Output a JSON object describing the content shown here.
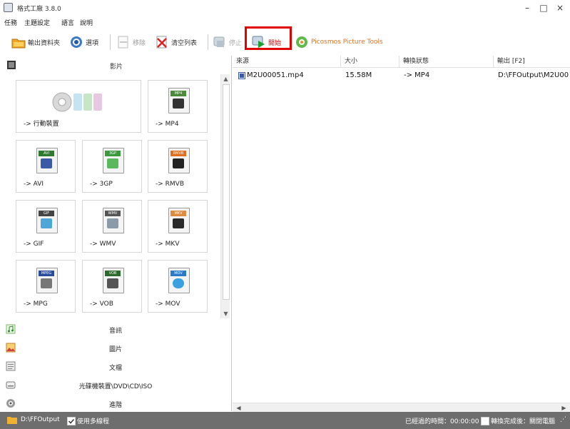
{
  "window": {
    "title": "格式工廠 3.8.0",
    "minimize_label": "–",
    "maximize_label": "□",
    "close_label": "×"
  },
  "menu": [
    "任務",
    "主題設定",
    "語言",
    "說明"
  ],
  "toolbar": {
    "output_folder": "輸出資料夾",
    "options": "選項",
    "remove": "移除",
    "clear_list": "清空列表",
    "stop": "停止",
    "start": "開始",
    "picosmos": "Picosmos Picture Tools",
    "accent": "#e00000"
  },
  "left": {
    "video_header": "影片",
    "tiles": [
      {
        "label": "-> 行動裝置",
        "icon": "mobile-device-icon"
      },
      {
        "label": "-> MP4",
        "badge": "MP4",
        "icon": "mp4-file-icon"
      },
      {
        "label": "-> AVI",
        "badge": "AVI",
        "icon": "avi-file-icon"
      },
      {
        "label": "-> 3GP",
        "badge": "3GP",
        "icon": "3gp-file-icon"
      },
      {
        "label": "-> RMVB",
        "badge": "RMVB",
        "icon": "rmvb-file-icon"
      },
      {
        "label": "-> GIF",
        "badge": "GIF",
        "icon": "gif-file-icon"
      },
      {
        "label": "-> WMV",
        "badge": "WMV",
        "icon": "wmv-file-icon"
      },
      {
        "label": "-> MKV",
        "badge": "MKV",
        "icon": "mkv-file-icon"
      },
      {
        "label": "-> MPG",
        "badge": "MPEG",
        "icon": "mpg-file-icon"
      },
      {
        "label": "-> VOB",
        "badge": "VOB",
        "icon": "vob-file-icon"
      },
      {
        "label": "-> MOV",
        "badge": "MOV",
        "icon": "mov-file-icon"
      }
    ],
    "categories": [
      "音訊",
      "圖片",
      "文檔",
      "光碟機裝置\\DVD\\CD\\ISO",
      "進階"
    ]
  },
  "table": {
    "headers": [
      "來源",
      "大小",
      "轉換狀態",
      "輸出 [F2]"
    ],
    "rows": [
      {
        "source": "M2U00051.mp4",
        "size": "15.58M",
        "status": "-> MP4",
        "output": "D:\\FFOutput\\M2U00"
      }
    ]
  },
  "status": {
    "output_path": "D:\\FFOutput",
    "multithread": "使用多線程",
    "elapsed": "已經過的時間：00:00:00",
    "after_convert": "轉換完成後：關閉電腦"
  }
}
